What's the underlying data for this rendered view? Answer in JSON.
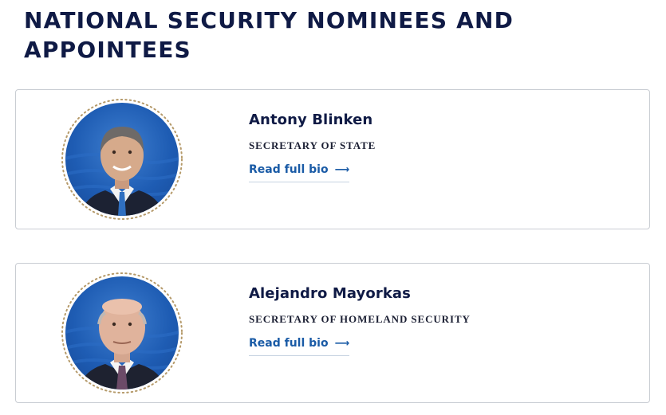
{
  "page": {
    "title": "NATIONAL SECURITY NOMINEES AND APPOINTEES"
  },
  "nominees": [
    {
      "name": "Antony Blinken",
      "role": "SECRETARY OF STATE",
      "link_label": "Read full bio",
      "link_icon": "arrow-right-icon"
    },
    {
      "name": "Alejandro Mayorkas",
      "role": "SECRETARY OF HOMELAND SECURITY",
      "link_label": "Read full bio",
      "link_icon": "arrow-right-icon"
    }
  ],
  "colors": {
    "heading": "#0f1a45",
    "link": "#1a5ba6",
    "portrait_background": "#1e5cb3",
    "ring_dots": "#b59a6a",
    "card_border": "#c9cdd3"
  }
}
